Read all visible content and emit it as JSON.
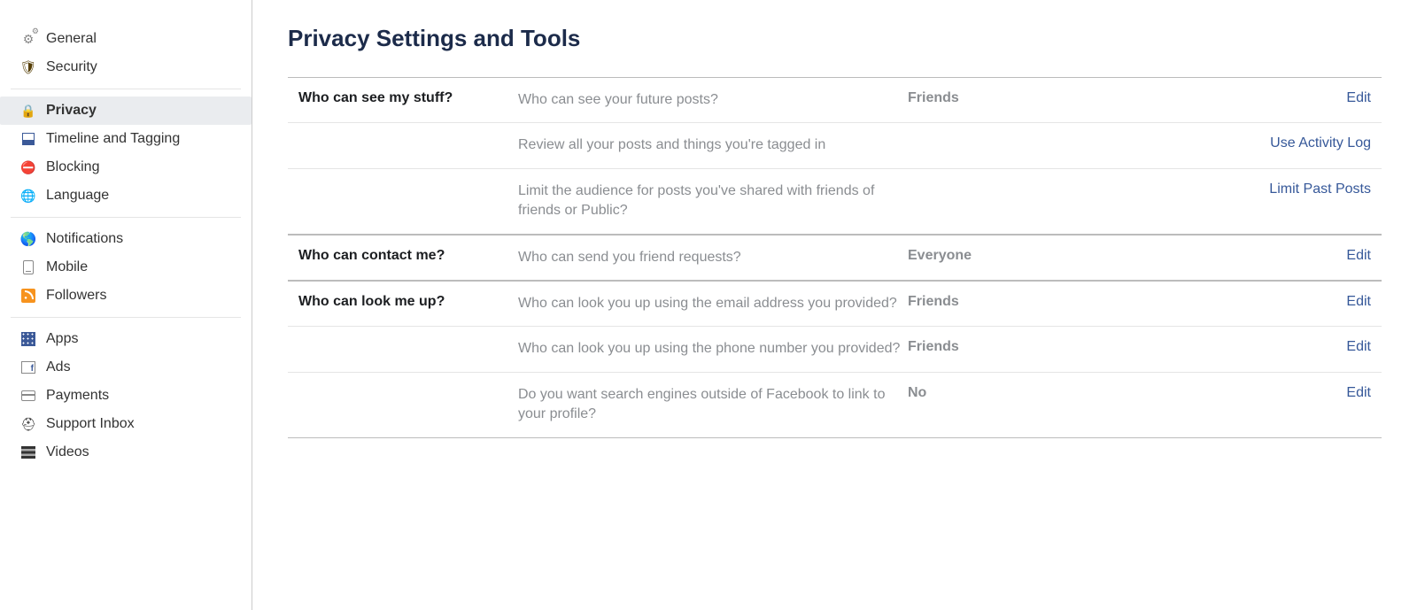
{
  "sidebar": {
    "groups": [
      {
        "items": [
          {
            "id": "general",
            "label": "General",
            "icon": "gear-icon",
            "active": false
          },
          {
            "id": "security",
            "label": "Security",
            "icon": "shield-icon",
            "active": false
          }
        ]
      },
      {
        "items": [
          {
            "id": "privacy",
            "label": "Privacy",
            "icon": "lock-icon",
            "active": true
          },
          {
            "id": "timeline",
            "label": "Timeline and Tagging",
            "icon": "timeline-icon",
            "active": false
          },
          {
            "id": "blocking",
            "label": "Blocking",
            "icon": "block-icon",
            "active": false
          },
          {
            "id": "language",
            "label": "Language",
            "icon": "globe-icon",
            "active": false
          }
        ]
      },
      {
        "items": [
          {
            "id": "notifications",
            "label": "Notifications",
            "icon": "earth-icon",
            "active": false
          },
          {
            "id": "mobile",
            "label": "Mobile",
            "icon": "mobile-icon",
            "active": false
          },
          {
            "id": "followers",
            "label": "Followers",
            "icon": "rss-icon",
            "active": false
          }
        ]
      },
      {
        "items": [
          {
            "id": "apps",
            "label": "Apps",
            "icon": "apps-icon",
            "active": false
          },
          {
            "id": "ads",
            "label": "Ads",
            "icon": "ads-icon",
            "active": false
          },
          {
            "id": "payments",
            "label": "Payments",
            "icon": "card-icon",
            "active": false
          },
          {
            "id": "support",
            "label": "Support Inbox",
            "icon": "life-ring-icon",
            "active": false
          },
          {
            "id": "videos",
            "label": "Videos",
            "icon": "video-icon",
            "active": false
          }
        ]
      }
    ]
  },
  "page": {
    "title": "Privacy Settings and Tools"
  },
  "sections": [
    {
      "heading": "Who can see my stuff?",
      "rows": [
        {
          "question": "Who can see your future posts?",
          "value": "Friends",
          "action": "Edit"
        },
        {
          "question": "Review all your posts and things you're tagged in",
          "value": "",
          "action": "Use Activity Log"
        },
        {
          "question": "Limit the audience for posts you've shared with friends of friends or Public?",
          "value": "",
          "action": "Limit Past Posts"
        }
      ]
    },
    {
      "heading": "Who can contact me?",
      "rows": [
        {
          "question": "Who can send you friend requests?",
          "value": "Everyone",
          "action": "Edit"
        }
      ]
    },
    {
      "heading": "Who can look me up?",
      "rows": [
        {
          "question": "Who can look you up using the email address you provided?",
          "value": "Friends",
          "action": "Edit"
        },
        {
          "question": "Who can look you up using the phone number you provided?",
          "value": "Friends",
          "action": "Edit"
        },
        {
          "question": "Do you want search engines outside of Facebook to link to your profile?",
          "value": "No",
          "action": "Edit"
        }
      ]
    }
  ]
}
